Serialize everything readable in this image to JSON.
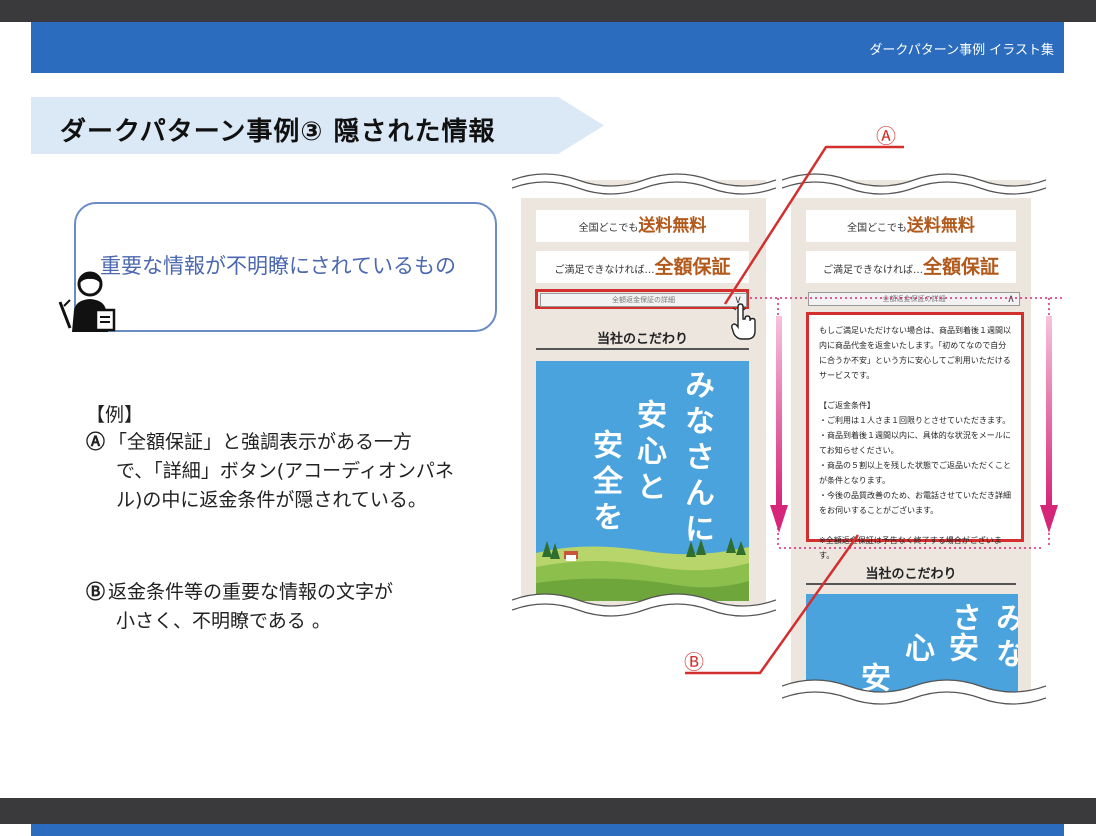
{
  "header": {
    "label": "ダークパターン事例 イラスト集"
  },
  "slide": {
    "title": "ダークパターン事例③  隠された情報",
    "callout": "重要な情報が不明瞭にされているもの",
    "example_heading": "【例】",
    "item_a_mark": "Ⓐ",
    "item_a_line1": "「全額保証」と強調表示がある一方",
    "item_a_rest": "で、「詳細」ボタン(アコーディオンパネル)の中に返金条件が隠されている。",
    "item_b_mark": "Ⓑ",
    "item_b_line1": "返金条件等の重要な情報の文字が",
    "item_b_rest": "小さく、不明瞭である 。"
  },
  "phone_left": {
    "free_shipping_prefix": "全国どこでも",
    "free_shipping": "送料無料",
    "guarantee_prefix": "ご満足できなければ…",
    "guarantee": "全額保証",
    "accordion_label": "全額返金保証の詳細",
    "accordion_chevron": "∨",
    "section_title": "当社のこだわり",
    "illust_col1": "みなさんに",
    "illust_col2": "安心と",
    "illust_col3": "安全を"
  },
  "phone_right": {
    "free_shipping_prefix": "全国どこでも",
    "free_shipping": "送料無料",
    "guarantee_prefix": "ご満足できなければ…",
    "guarantee": "全額保証",
    "accordion_label": "全額返金保証の詳細",
    "accordion_chevron": "∧",
    "panel_lines": [
      "もしご満足いただけない場合は、商品到着後１週間以",
      "内に商品代金を返金いたします。「初めてなので自分",
      "に合うか不安」という方に安心してご利用いただける",
      "サービスです。",
      "",
      "【ご返金条件】",
      "・ご利用は１人さま１回限りとさせていただきます。",
      "・商品到着後１週間以内に、具体的な状況をメールに",
      "てお知らせください。",
      "・商品の５割以上を残した状態でご返品いただくこと",
      "が条件となります。",
      "・今後の品質改善のため、お電話させていただき詳細",
      "をお伺いすることがございます。",
      "",
      "※全額返金保証は予告なく終了する場合がございます。"
    ],
    "section_title": "当社のこだわり",
    "illust_col1": "みなさ",
    "illust_col2": "安心",
    "illust_col3": "安"
  },
  "labels": {
    "a": "Ⓐ",
    "b": "Ⓑ"
  },
  "colors": {
    "header": "#2b6cbf",
    "accent_red": "#d32f2f",
    "arrow_pink": "#d6267a",
    "orange": "#b2591c"
  }
}
